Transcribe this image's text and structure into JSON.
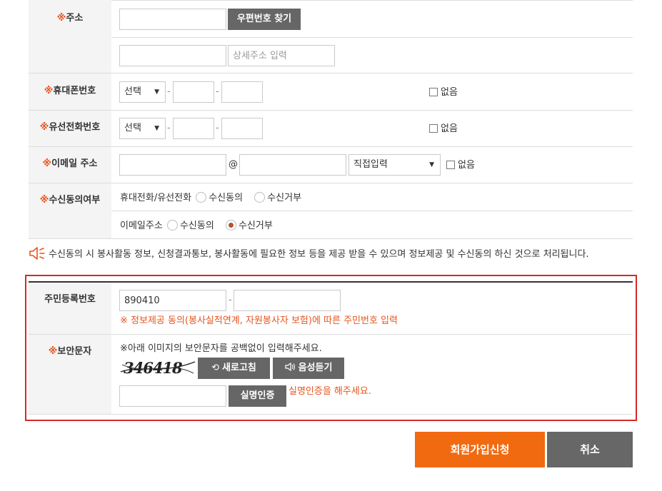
{
  "address": {
    "label_mark": "※",
    "label": "주소",
    "zip_button": "우편번호 찾기",
    "detail_placeholder": "상세주소 입력"
  },
  "mobile": {
    "label_mark": "※",
    "label": "휴대폰번호",
    "select_value": "선택",
    "none_label": "없음"
  },
  "landline": {
    "label_mark": "※",
    "label": "유선전화번호",
    "select_value": "선택",
    "none_label": "없음"
  },
  "email": {
    "label_mark": "※",
    "label": "이메일 주소",
    "at": "@",
    "domain_select": "직접입력",
    "none_label": "없음"
  },
  "consent": {
    "label_mark": "※",
    "label": "수신동의여부",
    "phone_label": "휴대전화/유선전화",
    "email_label": "이메일주소",
    "agree": "수신동의",
    "refuse": "수신거부"
  },
  "notice": "수신동의 시 봉사활동 정보, 신청결과통보, 봉사활동에 필요한 정보 등을 제공 받을 수 있으며 정보제공 및 수신동의 하신 것으로 처리됩니다.",
  "resident": {
    "label": "주민등록번호",
    "front_value": "890410",
    "dash": "-",
    "note": "※ 정보제공 동의(봉사실적연계, 자원봉사자 보험)에 따른 주민번호 입력"
  },
  "security": {
    "label_mark": "※",
    "label": "보안문자",
    "instruction": "※아래 이미지의 보안문자를 공백없이 입력해주세요.",
    "captcha_text": "346418",
    "refresh_button": "새로고침",
    "audio_button": "음성듣기",
    "verify_button": "실명인증",
    "verify_msg": "실명인증을 해주세요."
  },
  "actions": {
    "submit": "회원가입신청",
    "cancel": "취소"
  },
  "colors": {
    "accent": "#f26a10",
    "required": "#e8541e",
    "highlight_border": "#d42a2a",
    "button_gray": "#666666"
  }
}
